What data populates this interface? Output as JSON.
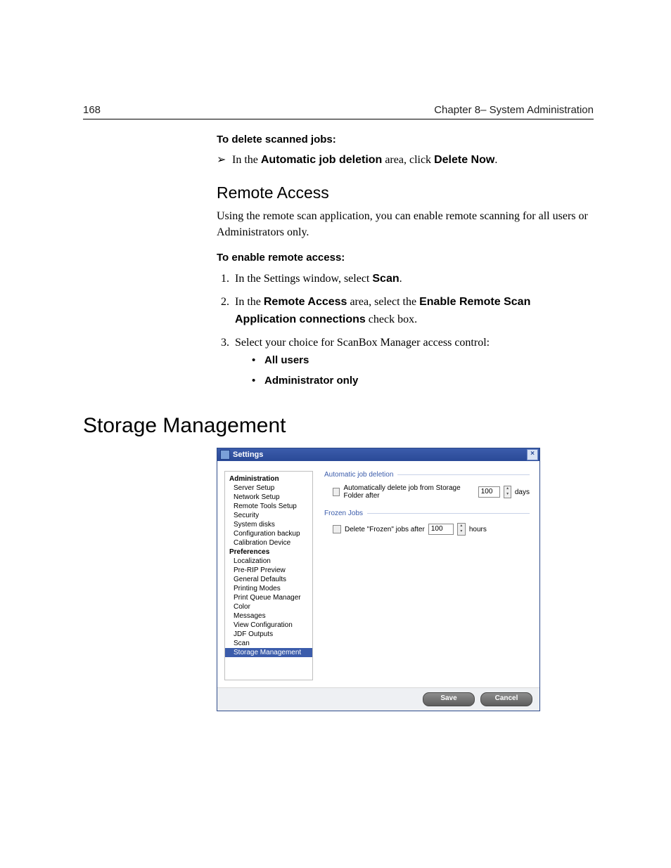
{
  "header": {
    "page_number": "168",
    "chapter": "Chapter 8– System Administration"
  },
  "body": {
    "task1_title": "To delete scanned jobs:",
    "task1_line_pre": "In the ",
    "task1_bold1": "Automatic job deletion",
    "task1_mid": " area, click ",
    "task1_bold2": "Delete Now",
    "task1_post": ".",
    "h3_remote": "Remote Access",
    "remote_para": "Using the remote scan application, you can enable remote scanning for all users or Administrators only.",
    "task2_title": "To enable remote access:",
    "step1_pre": "In the Settings window, select ",
    "step1_bold": "Scan",
    "step1_post": ".",
    "step2_pre": "In the ",
    "step2_bold1": "Remote Access",
    "step2_mid": " area, select the ",
    "step2_bold2": "Enable Remote Scan Application connections",
    "step2_post": " check box.",
    "step3": "Select your choice for ScanBox Manager access control:",
    "bullet1": "All users",
    "bullet2": "Administrator only",
    "h2_storage": "Storage Management"
  },
  "dlg": {
    "title": "Settings",
    "close": "×",
    "nav": {
      "admin_hdr": "Administration",
      "admin_items": [
        "Server Setup",
        "Network Setup",
        "Remote Tools Setup",
        "Security",
        "System disks",
        "Configuration backup",
        "Calibration Device"
      ],
      "pref_hdr": "Preferences",
      "pref_items": [
        "Localization",
        "Pre-RIP Preview",
        "General Defaults",
        "Printing Modes",
        "Print Queue Manager",
        "Color",
        "Messages",
        "View Configuration",
        "JDF Outputs",
        "Scan",
        "Storage Management"
      ],
      "selected": "Storage Management"
    },
    "panel": {
      "group1_legend": "Automatic job deletion",
      "group1_label": "Automatically delete job from Storage Folder after",
      "group1_value": "100",
      "group1_unit": "days",
      "group2_legend": "Frozen Jobs",
      "group2_label": "Delete \"Frozen\" jobs after",
      "group2_value": "100",
      "group2_unit": "hours"
    },
    "footer": {
      "save": "Save",
      "cancel": "Cancel"
    }
  }
}
